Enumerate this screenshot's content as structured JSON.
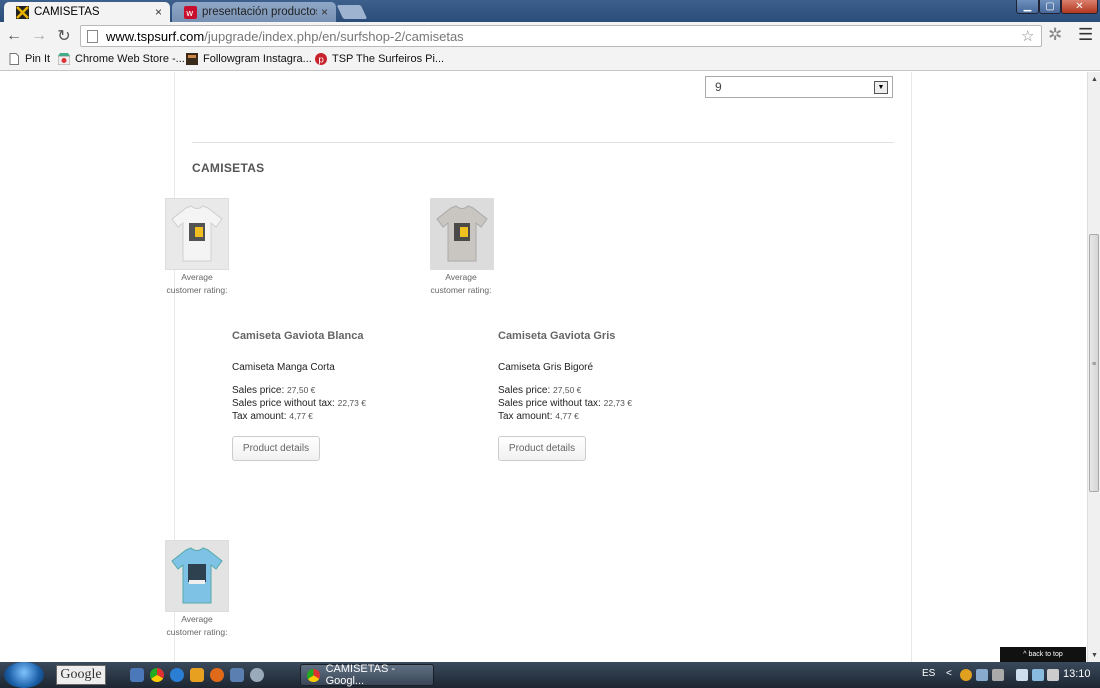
{
  "browser": {
    "tabs": [
      {
        "label": "CAMISETAS",
        "active": true
      },
      {
        "label": "presentación productos -",
        "active": false
      }
    ],
    "tab_close": "×",
    "url_host": "www.tspsurf.com",
    "url_path": "/jupgrade/index.php/en/surfshop-2/camisetas",
    "nav": {
      "back": "←",
      "forward": "→",
      "reload": "↻"
    },
    "star": "☆",
    "wrench": "✲",
    "menu": "☰",
    "window_controls": {
      "minimize": "▁",
      "maximize": "▢",
      "close": "✕"
    }
  },
  "bookmarks": [
    {
      "label": "Pin It",
      "icon": "page-icon"
    },
    {
      "label": "Chrome Web Store -...",
      "icon": "chrome-store-icon"
    },
    {
      "label": "Followgram Instagra...",
      "icon": "followgram-icon"
    },
    {
      "label": "TSP The Surfeiros Pi...",
      "icon": "pinterest-icon"
    }
  ],
  "page": {
    "select_value": "9",
    "select_arrow": "▼",
    "category_title": "CAMISETAS",
    "rating_label": "Average customer rating:",
    "rating_line1": "Average",
    "rating_line2": "customer rating:",
    "products": [
      {
        "name": "Camiseta Gaviota Blanca",
        "description": "Camiseta Manga Corta",
        "sales_price_label": "Sales price:",
        "sales_price": "27,50 €",
        "without_tax_label": "Sales price without tax:",
        "without_tax": "22,73 €",
        "tax_label": "Tax amount:",
        "tax": "4,77 €",
        "button": "Product details",
        "shirt_color": "#f4f4f4"
      },
      {
        "name": "Camiseta Gaviota Gris",
        "description": "Camiseta Gris Bigoré",
        "sales_price_label": "Sales price:",
        "sales_price": "27,50 €",
        "without_tax_label": "Sales price without tax:",
        "without_tax": "22,73 €",
        "tax_label": "Tax amount:",
        "tax": "4,77 €",
        "button": "Product details",
        "shirt_color": "#c9c6c2"
      },
      {
        "shirt_color": "#7ec3e6"
      }
    ],
    "back_to_top": "^ back to top"
  },
  "taskbar": {
    "google": "Google",
    "task_label": "CAMISETAS - Googl...",
    "lang": "ES",
    "chevron": "<",
    "time": "13:10"
  }
}
